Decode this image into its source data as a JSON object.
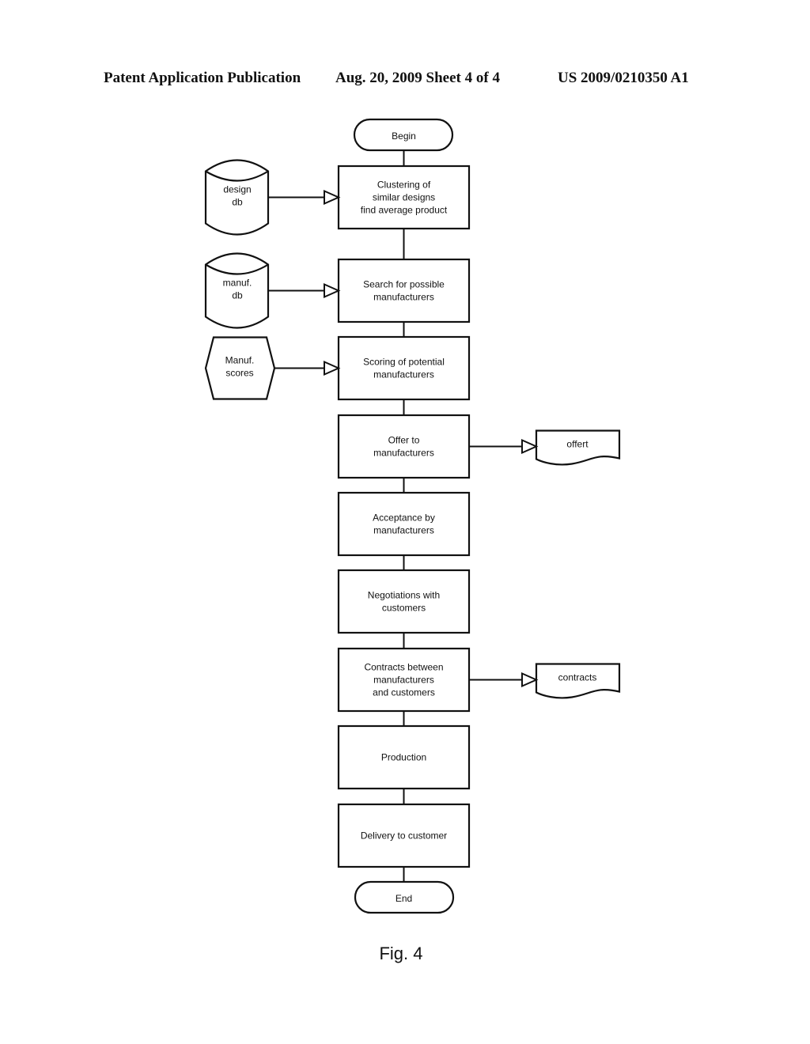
{
  "header": {
    "left": "Patent Application Publication",
    "middle": "Aug. 20, 2009  Sheet 4 of 4",
    "right": "US 2009/0210350 A1"
  },
  "flowchart": {
    "begin": "Begin",
    "end": "End",
    "steps": [
      {
        "id": "clustering",
        "lines": [
          "Clustering of",
          "similar designs",
          "find average product"
        ]
      },
      {
        "id": "search",
        "lines": [
          "Search for possible",
          "manufacturers"
        ]
      },
      {
        "id": "scoring",
        "lines": [
          "Scoring of potential",
          "manufacturers"
        ]
      },
      {
        "id": "offer",
        "lines": [
          "Offer to",
          "manufacturers"
        ]
      },
      {
        "id": "acceptance",
        "lines": [
          "Acceptance by",
          "manufacturers"
        ]
      },
      {
        "id": "negotiations",
        "lines": [
          "Negotiations with",
          "customers"
        ]
      },
      {
        "id": "contracts",
        "lines": [
          "Contracts between",
          "manufacturers",
          "and customers"
        ]
      },
      {
        "id": "production",
        "lines": [
          "Production"
        ]
      },
      {
        "id": "delivery",
        "lines": [
          "Delivery to customer"
        ]
      }
    ],
    "inputs": [
      {
        "id": "design-db",
        "shape": "database",
        "target": "clustering",
        "lines": [
          "design",
          "db"
        ]
      },
      {
        "id": "manuf-db",
        "shape": "database",
        "target": "search",
        "lines": [
          "manuf.",
          "db"
        ]
      },
      {
        "id": "manuf-scores",
        "shape": "hexagon",
        "target": "scoring",
        "lines": [
          "Manuf.",
          "scores"
        ]
      }
    ],
    "outputs": [
      {
        "id": "offert-doc",
        "shape": "document",
        "source": "offer",
        "lines": [
          "offert"
        ]
      },
      {
        "id": "contracts-doc",
        "shape": "document",
        "source": "contracts",
        "lines": [
          "contracts"
        ]
      }
    ]
  },
  "caption": "Fig. 4"
}
